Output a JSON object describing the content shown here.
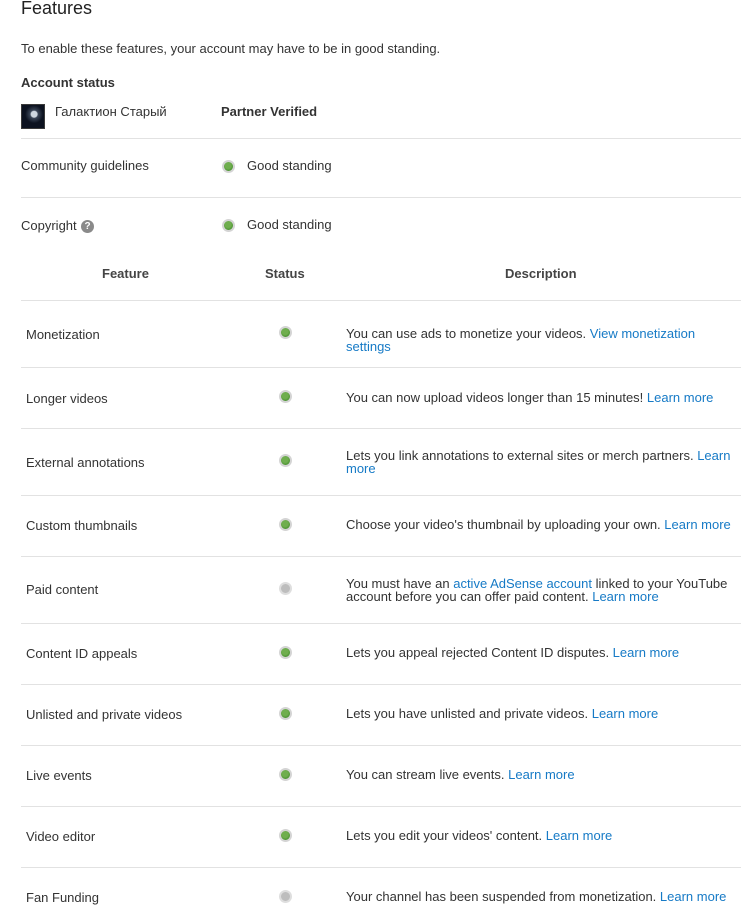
{
  "header": {
    "title": "Features",
    "intro": "To enable these features, your account may have to be in good standing."
  },
  "account": {
    "section_title": "Account status",
    "name": "Галактион Старый",
    "verified_label": "Partner Verified"
  },
  "standing": [
    {
      "label": "Community guidelines",
      "value": "Good standing",
      "status": "green"
    },
    {
      "label": "Copyright",
      "value": "Good standing",
      "status": "green",
      "help_icon": "help-icon",
      "help_glyph": "?"
    }
  ],
  "table": {
    "headers": {
      "feature": "Feature",
      "status": "Status",
      "description": "Description"
    },
    "rows": [
      {
        "feature": "Monetization",
        "status": "green",
        "desc_pre": "You can use ads to monetize your videos. ",
        "link1": "View monetization settings",
        "desc_mid": "",
        "link2": ""
      },
      {
        "feature": "Longer videos",
        "status": "green",
        "desc_pre": "You can now upload videos longer than 15 minutes! ",
        "link1": "Learn more",
        "desc_mid": "",
        "link2": ""
      },
      {
        "feature": "External annotations",
        "status": "green",
        "desc_pre": "Lets you link annotations to external sites or merch partners. ",
        "link1": "Learn more",
        "desc_mid": "",
        "link2": ""
      },
      {
        "feature": "Custom thumbnails",
        "status": "green",
        "desc_pre": "Choose your video's thumbnail by uploading your own. ",
        "link1": "Learn more",
        "desc_mid": "",
        "link2": ""
      },
      {
        "feature": "Paid content",
        "status": "gray",
        "desc_pre": "You must have an ",
        "link1": "active AdSense account",
        "desc_mid": " linked to your YouTube account before you can offer paid content. ",
        "link2": "Learn more"
      },
      {
        "feature": "Content ID appeals",
        "status": "green",
        "desc_pre": "Lets you appeal rejected Content ID disputes. ",
        "link1": "Learn more",
        "desc_mid": "",
        "link2": ""
      },
      {
        "feature": "Unlisted and private videos",
        "status": "green",
        "desc_pre": "Lets you have unlisted and private videos. ",
        "link1": "Learn more",
        "desc_mid": "",
        "link2": ""
      },
      {
        "feature": "Live events",
        "status": "green",
        "desc_pre": "You can stream live events. ",
        "link1": "Learn more",
        "desc_mid": "",
        "link2": ""
      },
      {
        "feature": "Video editor",
        "status": "green",
        "desc_pre": "Lets you edit your videos' content. ",
        "link1": "Learn more",
        "desc_mid": "",
        "link2": ""
      },
      {
        "feature": "Fan Funding",
        "status": "gray",
        "desc_pre": "Your channel has been suspended from monetization. ",
        "link1": "Learn more",
        "desc_mid": "",
        "link2": ""
      }
    ]
  },
  "colors": {
    "link": "#167ac6",
    "status_green": "#3f8a2a",
    "status_gray": "#bdbdbd",
    "divider": "#e2e2e2"
  }
}
